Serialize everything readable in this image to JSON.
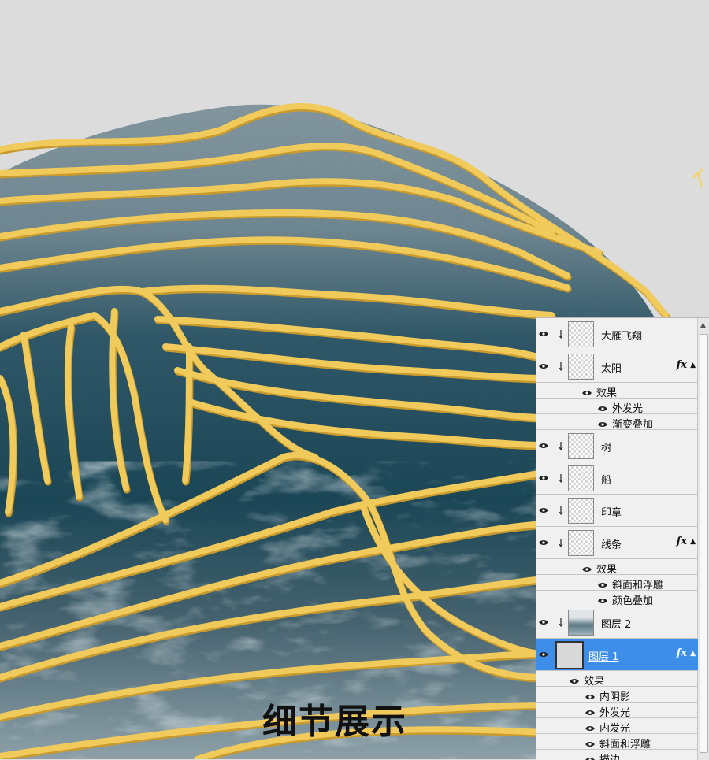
{
  "caption": "细节展示",
  "layers_panel": {
    "layers": [
      {
        "name": "大雁飞翔",
        "thumb": "checker",
        "fx": false,
        "clipped": true
      },
      {
        "name": "太阳",
        "thumb": "checker",
        "fx": true,
        "clipped": true,
        "effects_label": "效果",
        "effects": [
          "外发光",
          "渐变叠加"
        ]
      },
      {
        "name": "树",
        "thumb": "checker",
        "fx": false,
        "clipped": true
      },
      {
        "name": "船",
        "thumb": "checker",
        "fx": false,
        "clipped": true
      },
      {
        "name": "印章",
        "thumb": "checker",
        "fx": false,
        "clipped": true
      },
      {
        "name": "线条",
        "thumb": "checker",
        "fx": true,
        "clipped": true,
        "effects_label": "效果",
        "effects": [
          "斜面和浮雕",
          "颜色叠加"
        ]
      },
      {
        "name": "图层 2",
        "thumb": "dark",
        "fx": false,
        "clipped": true
      },
      {
        "name": "图层 1",
        "thumb": "gray",
        "fx": true,
        "clipped": false,
        "selected": true,
        "effects_label": "效果",
        "effects": [
          "内阴影",
          "外发光",
          "内发光",
          "斜面和浮雕",
          "描边"
        ]
      }
    ],
    "fx_label": "fx"
  },
  "colors": {
    "background": "#dcdcdc",
    "blob_dark": "#1b4656",
    "blob_light": "#5f7a86",
    "gold_line": "#f0cb5c",
    "gold_shadow": "#c99a2e",
    "selection": "#3d8ee9"
  }
}
